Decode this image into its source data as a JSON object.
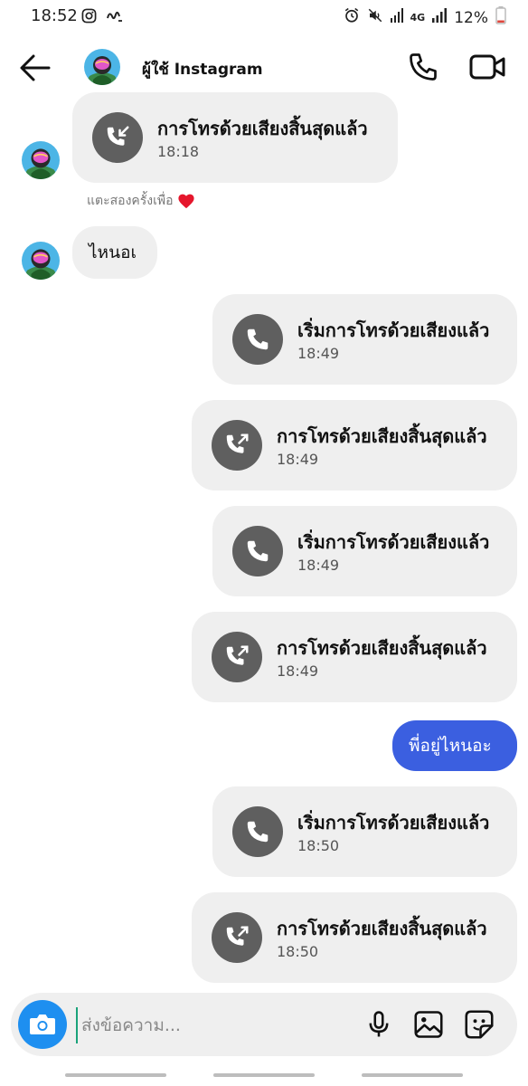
{
  "status_bar": {
    "time": "18:52",
    "network": "4G",
    "battery": "12%",
    "icons": [
      "instagram-icon",
      "ais-icon",
      "alarm-icon",
      "mute-icon",
      "signal-icon",
      "battery-icon"
    ]
  },
  "header": {
    "username": "ผู้ใช้ Instagram",
    "icons": [
      "back-arrow-icon",
      "phone-icon",
      "video-camera-icon"
    ]
  },
  "reaction_hint": "แตะสองครั้งเพื่อ",
  "messages": [
    {
      "side": "received",
      "kind": "call",
      "direction": "incoming-ended",
      "text": "การโทรด้วยเสียงสิ้นสุดแล้ว",
      "time": "18:18"
    },
    {
      "side": "received",
      "kind": "text",
      "text": "ไหนอเ"
    },
    {
      "side": "sent",
      "kind": "call",
      "direction": "started",
      "text": "เริ่มการโทรด้วยเสียงแล้ว",
      "time": "18:49"
    },
    {
      "side": "sent",
      "kind": "call",
      "direction": "outgoing-ended",
      "text": "การโทรด้วยเสียงสิ้นสุดแล้ว",
      "time": "18:49"
    },
    {
      "side": "sent",
      "kind": "call",
      "direction": "started",
      "text": "เริ่มการโทรด้วยเสียงแล้ว",
      "time": "18:49"
    },
    {
      "side": "sent",
      "kind": "call",
      "direction": "outgoing-ended",
      "text": "การโทรด้วยเสียงสิ้นสุดแล้ว",
      "time": "18:49"
    },
    {
      "side": "sent",
      "kind": "text",
      "text": "พี่อยู่ไหนอะ"
    },
    {
      "side": "sent",
      "kind": "call",
      "direction": "started",
      "text": "เริ่มการโทรด้วยเสียงแล้ว",
      "time": "18:50"
    },
    {
      "side": "sent",
      "kind": "call",
      "direction": "outgoing-ended",
      "text": "การโทรด้วยเสียงสิ้นสุดแล้ว",
      "time": "18:50"
    }
  ],
  "composer": {
    "placeholder": "ส่งข้อความ...",
    "icons": [
      "camera-icon",
      "microphone-icon",
      "gallery-icon",
      "sticker-icon"
    ]
  },
  "colors": {
    "bubble_gray": "#efefef",
    "sent_blue": "#3b5fe0",
    "camera_blue": "#1e8ff0",
    "call_icon_gray": "#5f5f5f"
  }
}
